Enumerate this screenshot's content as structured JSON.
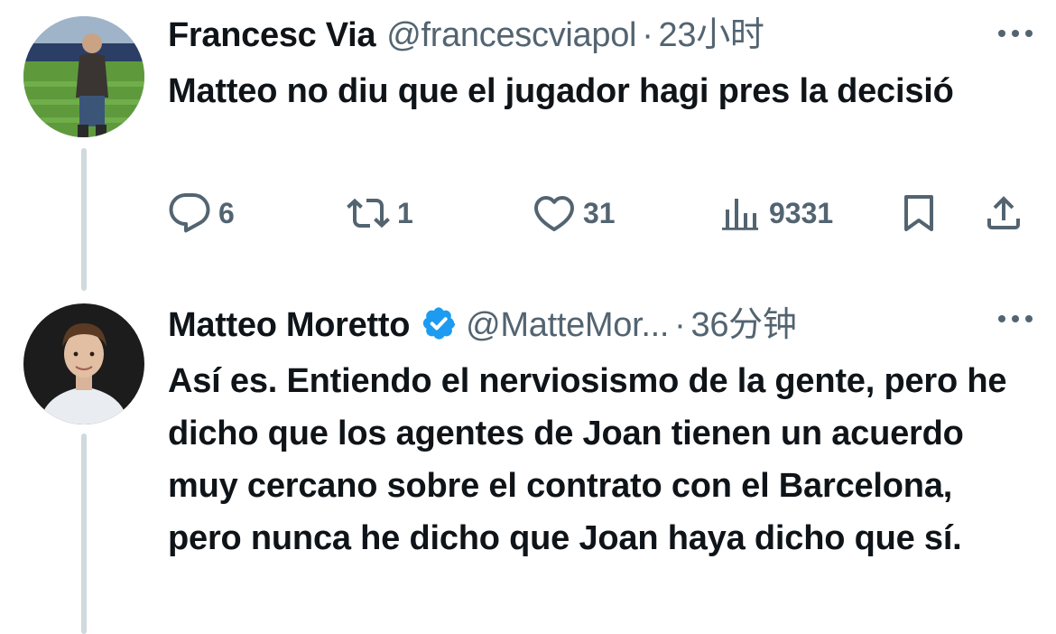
{
  "tweets": [
    {
      "display_name": "Francesc Via",
      "handle": "@francescviapol",
      "separator": "·",
      "time": "23小时",
      "text": "Matteo no diu que el jugador hagi pres la decisió",
      "verified": false,
      "stats": {
        "replies": "6",
        "retweets": "1",
        "likes": "31",
        "views": "9331"
      }
    },
    {
      "display_name": "Matteo Moretto",
      "handle": "@MatteMor...",
      "separator": "·",
      "time": "36分钟",
      "text": "Así es. Entiendo el nerviosismo de la gente, pero he dicho que los agentes de Joan tienen un acuerdo muy cercano sobre el contrato con el Barcelona, pero nunca he dicho que Joan haya dicho que sí.",
      "verified": true
    }
  ],
  "colors": {
    "text_primary": "#0f1419",
    "text_secondary": "#536471",
    "verified_blue": "#1d9bf0",
    "thread_line": "#cfd9de"
  },
  "icons": {
    "reply": "reply-icon",
    "retweet": "retweet-icon",
    "like": "heart-icon",
    "views": "views-icon",
    "bookmark": "bookmark-icon",
    "share": "share-icon",
    "more": "more-icon",
    "verified": "verified-badge-icon"
  }
}
